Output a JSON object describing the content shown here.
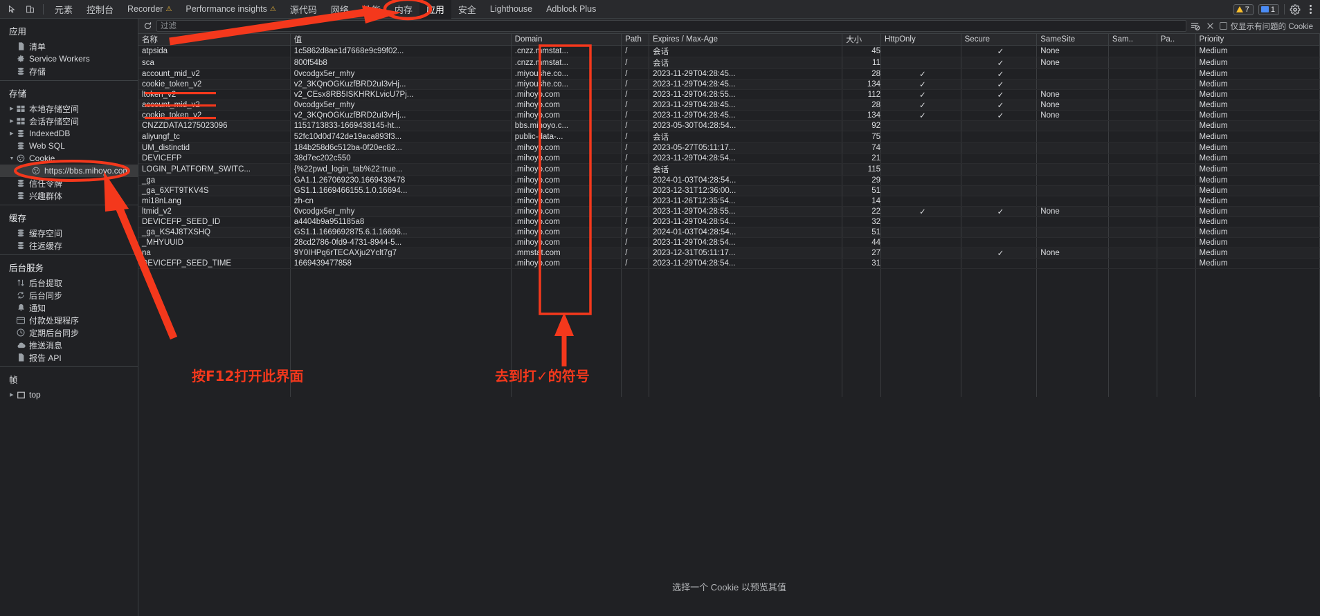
{
  "toolbar": {
    "icons": [
      "inspect-icon",
      "device-toggle-icon"
    ],
    "tabs": [
      {
        "label": "元素",
        "cjk": true,
        "selected": false,
        "warn": false
      },
      {
        "label": "控制台",
        "cjk": true,
        "selected": false,
        "warn": false
      },
      {
        "label": "Recorder",
        "cjk": false,
        "selected": false,
        "warn": true
      },
      {
        "label": "Performance insights",
        "cjk": false,
        "selected": false,
        "warn": true
      },
      {
        "label": "源代码",
        "cjk": true,
        "selected": false,
        "warn": false
      },
      {
        "label": "网络",
        "cjk": true,
        "selected": false,
        "warn": false
      },
      {
        "label": "性能",
        "cjk": true,
        "selected": false,
        "warn": false
      },
      {
        "label": "内存",
        "cjk": true,
        "selected": false,
        "warn": false
      },
      {
        "label": "应用",
        "cjk": true,
        "selected": true,
        "warn": false
      },
      {
        "label": "安全",
        "cjk": true,
        "selected": false,
        "warn": false
      },
      {
        "label": "Lighthouse",
        "cjk": false,
        "selected": false,
        "warn": false
      },
      {
        "label": "Adblock Plus",
        "cjk": false,
        "selected": false,
        "warn": false
      }
    ],
    "warning_count": "7",
    "message_count": "1",
    "settings_label": "gear-icon",
    "more_label": "kebab-menu-icon"
  },
  "sidebar": {
    "sections": [
      {
        "title": "应用",
        "items": [
          {
            "label": "清单",
            "icon": "manifest-icon",
            "arrow": false,
            "indent": 1,
            "selected": false
          },
          {
            "label": "Service Workers",
            "icon": "gear-icon",
            "arrow": false,
            "indent": 1,
            "selected": false
          },
          {
            "label": "存储",
            "icon": "database-icon",
            "arrow": false,
            "indent": 1,
            "selected": false
          }
        ]
      },
      {
        "title": "存储",
        "items": [
          {
            "label": "本地存储空间",
            "icon": "table-icon",
            "arrow": true,
            "indent": 1,
            "selected": false
          },
          {
            "label": "会话存储空间",
            "icon": "table-icon",
            "arrow": true,
            "indent": 1,
            "selected": false
          },
          {
            "label": "IndexedDB",
            "icon": "database-icon",
            "arrow": true,
            "indent": 1,
            "selected": false
          },
          {
            "label": "Web SQL",
            "icon": "database-icon",
            "arrow": false,
            "indent": 1,
            "selected": false
          },
          {
            "label": "Cookie",
            "icon": "cookie-icon",
            "arrow": true,
            "expanded": true,
            "indent": 1,
            "selected": false
          },
          {
            "label": "https://bbs.mihoyo.com",
            "icon": "cookie-icon",
            "arrow": false,
            "indent": 2,
            "selected": true
          },
          {
            "label": "信任令牌",
            "icon": "database-icon",
            "arrow": false,
            "indent": 1,
            "selected": false
          },
          {
            "label": "兴趣群体",
            "icon": "database-icon",
            "arrow": false,
            "indent": 1,
            "selected": false
          }
        ]
      },
      {
        "title": "缓存",
        "items": [
          {
            "label": "缓存空间",
            "icon": "database-icon",
            "arrow": false,
            "indent": 1,
            "selected": false
          },
          {
            "label": "往返缓存",
            "icon": "database-icon",
            "arrow": false,
            "indent": 1,
            "selected": false
          }
        ]
      },
      {
        "title": "后台服务",
        "items": [
          {
            "label": "后台提取",
            "icon": "arrows-updown-icon",
            "arrow": false,
            "indent": 1,
            "selected": false
          },
          {
            "label": "后台同步",
            "icon": "sync-icon",
            "arrow": false,
            "indent": 1,
            "selected": false
          },
          {
            "label": "通知",
            "icon": "bell-icon",
            "arrow": false,
            "indent": 1,
            "selected": false
          },
          {
            "label": "付款处理程序",
            "icon": "card-icon",
            "arrow": false,
            "indent": 1,
            "selected": false
          },
          {
            "label": "定期后台同步",
            "icon": "clock-icon",
            "arrow": false,
            "indent": 1,
            "selected": false
          },
          {
            "label": "推送消息",
            "icon": "cloud-icon",
            "arrow": false,
            "indent": 1,
            "selected": false
          },
          {
            "label": "报告 API",
            "icon": "document-icon",
            "arrow": false,
            "indent": 1,
            "selected": false
          }
        ]
      },
      {
        "title": "帧",
        "items": [
          {
            "label": "top",
            "icon": "frame-icon",
            "arrow": true,
            "indent": 1,
            "selected": false
          }
        ]
      }
    ]
  },
  "filter_bar": {
    "refresh_icon": "refresh-icon",
    "filter_placeholder": "过滤",
    "filter_value": "",
    "clear_filtered_icon": "clear-filtered-cookies-icon",
    "clear_all_icon": "clear-all-cookies-icon",
    "only_problem_checkbox_label": "仅显示有问题的 Cookie",
    "only_problem_checked": false
  },
  "table": {
    "columns": [
      "名称",
      "值",
      "Domain",
      "Path",
      "Expires / Max-Age",
      "大小",
      "HttpOnly",
      "Secure",
      "SameSite",
      "Sam..",
      "Pa..",
      "Priority"
    ],
    "rows": [
      {
        "name": "atpsida",
        "value": "1c5862d8ae1d7668e9c99f02...",
        "domain": ".cnzz.mmstat...",
        "path": "/",
        "expires": "会话",
        "size": "45",
        "httponly": "",
        "secure": "✓",
        "samesite": "None",
        "samesite2": "",
        "partition": "",
        "priority": "Medium"
      },
      {
        "name": "sca",
        "value": "800f54b8",
        "domain": ".cnzz.mmstat...",
        "path": "/",
        "expires": "会话",
        "size": "11",
        "httponly": "",
        "secure": "✓",
        "samesite": "None",
        "samesite2": "",
        "partition": "",
        "priority": "Medium"
      },
      {
        "name": "account_mid_v2",
        "value": "0vcodgx5er_mhy",
        "domain": ".miyoushe.co...",
        "path": "/",
        "expires": "2023-11-29T04:28:45...",
        "size": "28",
        "httponly": "✓",
        "secure": "✓",
        "samesite": "",
        "samesite2": "",
        "partition": "",
        "priority": "Medium"
      },
      {
        "name": "cookie_token_v2",
        "value": "v2_3KQnOGKuzfBRD2uI3vHj...",
        "domain": ".miyoushe.co...",
        "path": "/",
        "expires": "2023-11-29T04:28:45...",
        "size": "134",
        "httponly": "✓",
        "secure": "✓",
        "samesite": "",
        "samesite2": "",
        "partition": "",
        "priority": "Medium"
      },
      {
        "name": "ltoken_v2",
        "value": "v2_CEsx8RB5ISKHRKLvicU7Pj...",
        "domain": ".mihoyo.com",
        "path": "/",
        "expires": "2023-11-29T04:28:55...",
        "size": "112",
        "httponly": "✓",
        "secure": "✓",
        "samesite": "None",
        "samesite2": "",
        "partition": "",
        "priority": "Medium"
      },
      {
        "name": "account_mid_v2",
        "value": "0vcodgx5er_mhy",
        "domain": ".mihoyo.com",
        "path": "/",
        "expires": "2023-11-29T04:28:45...",
        "size": "28",
        "httponly": "✓",
        "secure": "✓",
        "samesite": "None",
        "samesite2": "",
        "partition": "",
        "priority": "Medium"
      },
      {
        "name": "cookie_token_v2",
        "value": "v2_3KQnOGKuzfBRD2uI3vHj...",
        "domain": ".mihoyo.com",
        "path": "/",
        "expires": "2023-11-29T04:28:45...",
        "size": "134",
        "httponly": "✓",
        "secure": "✓",
        "samesite": "None",
        "samesite2": "",
        "partition": "",
        "priority": "Medium"
      },
      {
        "name": "CNZZDATA1275023096",
        "value": "1151713833-1669438145-ht...",
        "domain": "bbs.mihoyo.c...",
        "path": "/",
        "expires": "2023-05-30T04:28:54...",
        "size": "92",
        "httponly": "",
        "secure": "",
        "samesite": "",
        "samesite2": "",
        "partition": "",
        "priority": "Medium"
      },
      {
        "name": "aliyungf_tc",
        "value": "52fc10d0d742de19aca893f3...",
        "domain": "public-data-...",
        "path": "/",
        "expires": "会话",
        "size": "75",
        "httponly": "",
        "secure": "",
        "samesite": "",
        "samesite2": "",
        "partition": "",
        "priority": "Medium"
      },
      {
        "name": "UM_distinctid",
        "value": "184b258d6c512ba-0f20ec82...",
        "domain": ".mihoyo.com",
        "path": "/",
        "expires": "2023-05-27T05:11:17...",
        "size": "74",
        "httponly": "",
        "secure": "",
        "samesite": "",
        "samesite2": "",
        "partition": "",
        "priority": "Medium"
      },
      {
        "name": "DEVICEFP",
        "value": "38d7ec202c550",
        "domain": ".mihoyo.com",
        "path": "/",
        "expires": "2023-11-29T04:28:54...",
        "size": "21",
        "httponly": "",
        "secure": "",
        "samesite": "",
        "samesite2": "",
        "partition": "",
        "priority": "Medium"
      },
      {
        "name": "LOGIN_PLATFORM_SWITC...",
        "value": "{%22pwd_login_tab%22:true...",
        "domain": ".mihoyo.com",
        "path": "/",
        "expires": "会话",
        "size": "115",
        "httponly": "",
        "secure": "",
        "samesite": "",
        "samesite2": "",
        "partition": "",
        "priority": "Medium"
      },
      {
        "name": "_ga",
        "value": "GA1.1.267069230.1669439478",
        "domain": ".mihoyo.com",
        "path": "/",
        "expires": "2024-01-03T04:28:54...",
        "size": "29",
        "httponly": "",
        "secure": "",
        "samesite": "",
        "samesite2": "",
        "partition": "",
        "priority": "Medium"
      },
      {
        "name": "_ga_6XFT9TKV4S",
        "value": "GS1.1.1669466155.1.0.16694...",
        "domain": ".mihoyo.com",
        "path": "/",
        "expires": "2023-12-31T12:36:00...",
        "size": "51",
        "httponly": "",
        "secure": "",
        "samesite": "",
        "samesite2": "",
        "partition": "",
        "priority": "Medium"
      },
      {
        "name": "mi18nLang",
        "value": "zh-cn",
        "domain": ".mihoyo.com",
        "path": "/",
        "expires": "2023-11-26T12:35:54...",
        "size": "14",
        "httponly": "",
        "secure": "",
        "samesite": "",
        "samesite2": "",
        "partition": "",
        "priority": "Medium"
      },
      {
        "name": "ltmid_v2",
        "value": "0vcodgx5er_mhy",
        "domain": ".mihoyo.com",
        "path": "/",
        "expires": "2023-11-29T04:28:55...",
        "size": "22",
        "httponly": "✓",
        "secure": "✓",
        "samesite": "None",
        "samesite2": "",
        "partition": "",
        "priority": "Medium"
      },
      {
        "name": "DEVICEFP_SEED_ID",
        "value": "a4404b9a951185a8",
        "domain": ".mihoyo.com",
        "path": "/",
        "expires": "2023-11-29T04:28:54...",
        "size": "32",
        "httponly": "",
        "secure": "",
        "samesite": "",
        "samesite2": "",
        "partition": "",
        "priority": "Medium"
      },
      {
        "name": "_ga_KS4J8TXSHQ",
        "value": "GS1.1.1669692875.6.1.16696...",
        "domain": ".mihoyo.com",
        "path": "/",
        "expires": "2024-01-03T04:28:54...",
        "size": "51",
        "httponly": "",
        "secure": "",
        "samesite": "",
        "samesite2": "",
        "partition": "",
        "priority": "Medium"
      },
      {
        "name": "_MHYUUID",
        "value": "28cd2786-0fd9-4731-8944-5...",
        "domain": ".mihoyo.com",
        "path": "/",
        "expires": "2023-11-29T04:28:54...",
        "size": "44",
        "httponly": "",
        "secure": "",
        "samesite": "",
        "samesite2": "",
        "partition": "",
        "priority": "Medium"
      },
      {
        "name": "na",
        "value": "9Y0IHPq6rTECAXju2Yclt7g7",
        "domain": ".mmstat.com",
        "path": "/",
        "expires": "2023-12-31T05:11:17...",
        "size": "27",
        "httponly": "",
        "secure": "✓",
        "samesite": "None",
        "samesite2": "",
        "partition": "",
        "priority": "Medium"
      },
      {
        "name": "DEVICEFP_SEED_TIME",
        "value": "1669439477858",
        "domain": ".mihoyo.com",
        "path": "/",
        "expires": "2023-11-29T04:28:54...",
        "size": "31",
        "httponly": "",
        "secure": "",
        "samesite": "",
        "samesite2": "",
        "partition": "",
        "priority": "Medium"
      }
    ]
  },
  "preview": {
    "empty_message": "选择一个 Cookie 以预览其值"
  },
  "annotations": {
    "accent_color": "#f4381c",
    "note_open_devtools": "按F12打开此界面",
    "note_checkmarks": "去到打✓的符号"
  }
}
